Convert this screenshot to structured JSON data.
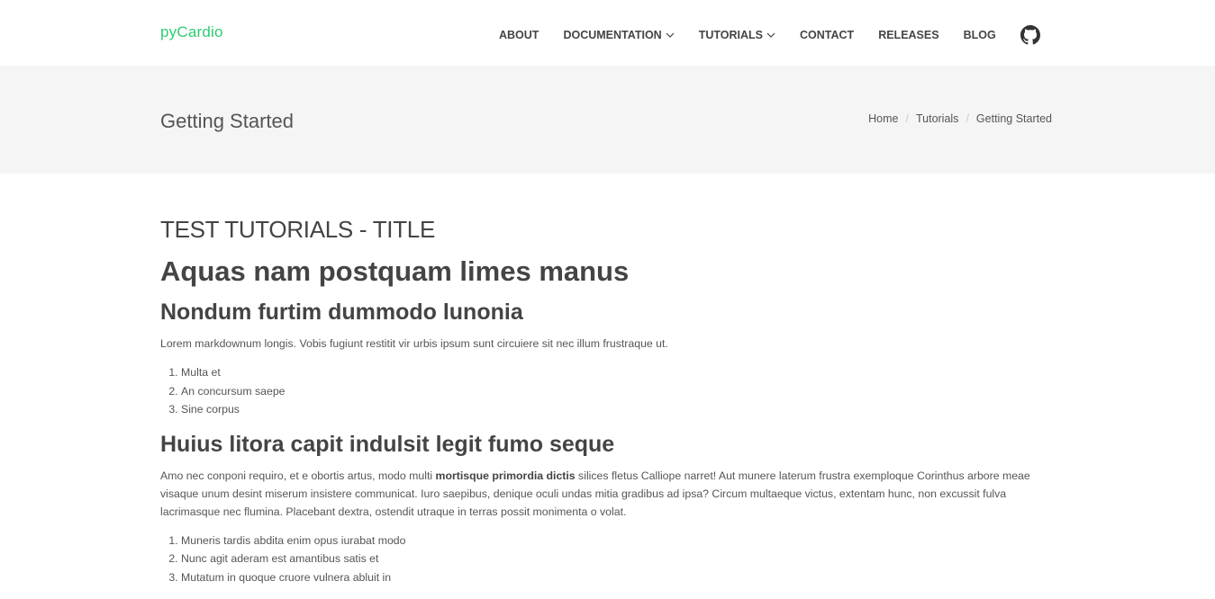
{
  "navbar": {
    "brand": "pyCardio",
    "items": [
      {
        "label": "ABOUT",
        "dropdown": false
      },
      {
        "label": "DOCUMENTATION",
        "dropdown": true
      },
      {
        "label": "TUTORIALS",
        "dropdown": true
      },
      {
        "label": "CONTACT",
        "dropdown": false
      },
      {
        "label": "RELEASES",
        "dropdown": false
      },
      {
        "label": "BLOG",
        "dropdown": false
      }
    ],
    "github_icon": "github-icon"
  },
  "header": {
    "title": "Getting Started",
    "breadcrumb": [
      "Home",
      "Tutorials",
      "Getting Started"
    ]
  },
  "content": {
    "test_title": "TEST TUTORIALS - TITLE",
    "h1": "Aquas nam postquam limes manus",
    "section1": {
      "heading": "Nondum furtim dummodo lunonia",
      "paragraph": "Lorem markdownum longis. Vobis fugiunt restitit vir urbis ipsum sunt circuiere sit nec illum frustraque ut.",
      "list": [
        "Multa et",
        "An concursum saepe",
        "Sine corpus"
      ]
    },
    "section2": {
      "heading": "Huius litora capit indulsit legit fumo seque",
      "paragraph_before": "Amo nec conponi requiro, et e obortis artus, modo multi ",
      "paragraph_bold": "mortisque primordia dictis",
      "paragraph_after": " silices fletus Calliope narret! Aut munere laterum frustra exemploque Corinthus arbore meae visaque unum desint miserum insistere communicat. Iuro saepibus, denique oculi undas mitia gradibus ad ipsa? Circum multaeque victus, extentam hunc, non excussit fulva lacrimasque nec flumina. Placebant dextra, ostendit utraque in terras possit monimenta o volat.",
      "list": [
        "Muneris tardis abdita enim opus iurabat modo",
        "Nunc agit aderam est amantibus satis et",
        "Mutatum in quoque cruore vulnera abluit in"
      ]
    }
  },
  "colors": {
    "brand": "#2ecc71",
    "header_bg": "#f5f5f5",
    "text": "#555555"
  }
}
